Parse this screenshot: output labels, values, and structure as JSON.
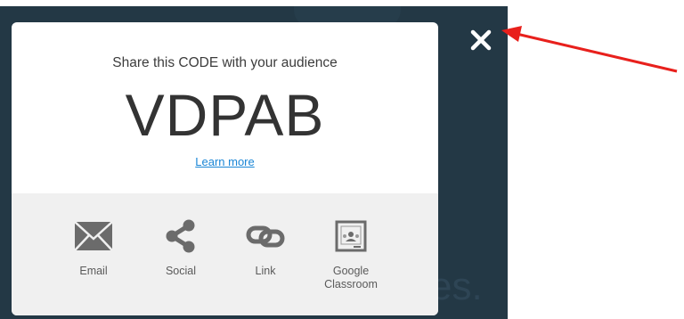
{
  "modal": {
    "title": "Share this CODE with your audience",
    "code": "VDPAB",
    "learn_more": "Learn more",
    "options": [
      {
        "label": "Email",
        "icon": "envelope-icon"
      },
      {
        "label": "Social",
        "icon": "share-icon"
      },
      {
        "label": "Link",
        "icon": "chain-link-icon"
      },
      {
        "label": "Google Classroom",
        "icon": "google-classroom-icon"
      }
    ]
  },
  "background": {
    "partial_text": "es."
  },
  "colors": {
    "backdrop": "#233845",
    "icon_gray": "#6b6b6b",
    "link": "#1a86d6",
    "arrow": "#e8201c"
  }
}
